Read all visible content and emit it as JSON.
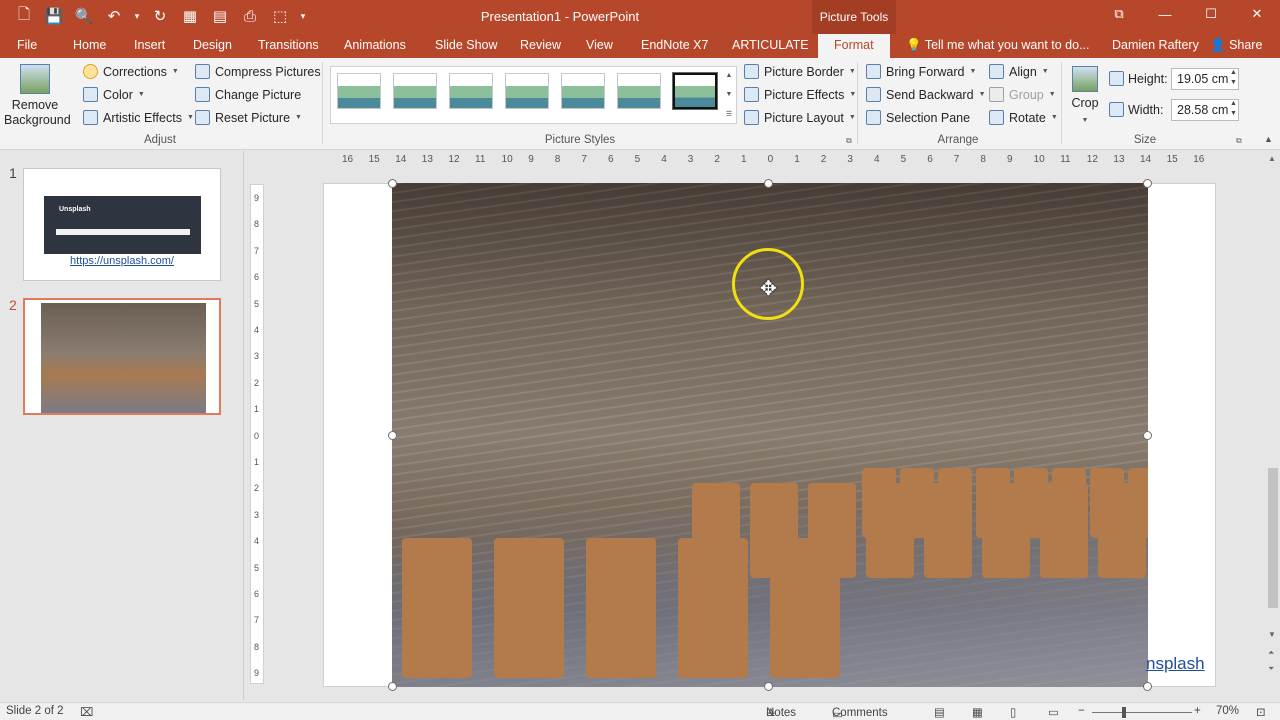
{
  "window": {
    "title": "Presentation1 - PowerPoint",
    "context_tab": "Picture Tools",
    "controls": [
      "⧉",
      "—",
      "☐",
      "✕"
    ]
  },
  "qat": [
    "🗋",
    "💾",
    "🔍",
    "↶",
    "▾",
    "↻",
    "▦",
    "▤",
    "⎙",
    "⬚",
    "▾"
  ],
  "tabs": [
    "File",
    "Home",
    "Insert",
    "Design",
    "Transitions",
    "Animations",
    "Slide Show",
    "Review",
    "View",
    "EndNote X7",
    "ARTICULATE",
    "Format"
  ],
  "tell_me": "Tell me what you want to do...",
  "user": "Damien Raftery",
  "share": "Share",
  "ribbon": {
    "remove_bg": "Remove Background",
    "adjust": {
      "label": "Adjust",
      "corrections": "Corrections",
      "color": "Color",
      "artistic": "Artistic Effects",
      "compress": "Compress Pictures",
      "change": "Change Picture",
      "reset": "Reset Picture"
    },
    "styles": {
      "label": "Picture Styles",
      "border": "Picture Border",
      "effects": "Picture Effects",
      "layout": "Picture Layout"
    },
    "arrange": {
      "label": "Arrange",
      "bring": "Bring Forward",
      "send": "Send Backward",
      "selection": "Selection Pane",
      "align": "Align",
      "group": "Group",
      "rotate": "Rotate"
    },
    "size": {
      "label": "Size",
      "crop": "Crop",
      "height_label": "Height:",
      "height": "19.05 cm",
      "width_label": "Width:",
      "width": "28.58 cm"
    }
  },
  "slides": [
    {
      "num": "1",
      "title": "Unsplash",
      "link": "https://unsplash.com/"
    },
    {
      "num": "2"
    }
  ],
  "ruler_h": [
    "16",
    "15",
    "14",
    "13",
    "12",
    "11",
    "10",
    "9",
    "8",
    "7",
    "6",
    "5",
    "4",
    "3",
    "2",
    "1",
    "0",
    "1",
    "2",
    "3",
    "4",
    "5",
    "6",
    "7",
    "8",
    "9",
    "10",
    "11",
    "12",
    "13",
    "14",
    "15",
    "16"
  ],
  "ruler_v": [
    "9",
    "8",
    "7",
    "6",
    "5",
    "4",
    "3",
    "2",
    "1",
    "0",
    "1",
    "2",
    "3",
    "4",
    "5",
    "6",
    "7",
    "8",
    "9"
  ],
  "slide_link": "nsplash",
  "status": {
    "slide": "Slide 2 of 2",
    "notes": "Notes",
    "comments": "Comments",
    "zoom": "70%"
  }
}
